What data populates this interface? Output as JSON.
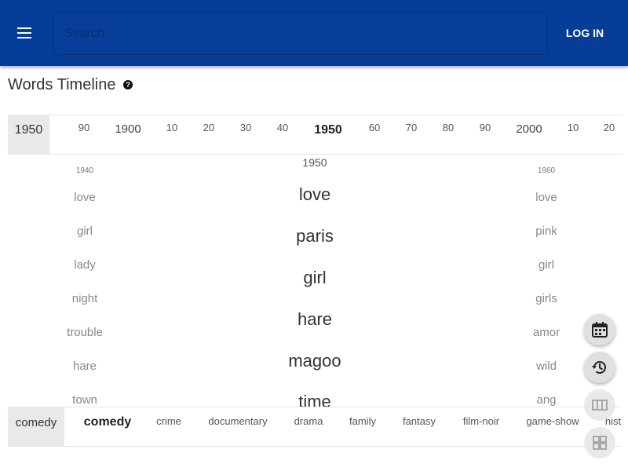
{
  "header": {
    "search_placeholder": "Search",
    "login_label": "LOG IN"
  },
  "page": {
    "title": "Words Timeline",
    "help_symbol": "?"
  },
  "year_nav": {
    "current": "1950",
    "ticks": [
      "90",
      "1900",
      "10",
      "20",
      "30",
      "40",
      "1950",
      "60",
      "70",
      "80",
      "90",
      "2000",
      "10",
      "20"
    ]
  },
  "columns": {
    "left": {
      "year": "1940",
      "words": [
        "love",
        "girl",
        "lady",
        "night",
        "trouble",
        "hare",
        "town"
      ]
    },
    "center": {
      "year": "1950",
      "words": [
        "love",
        "paris",
        "girl",
        "hare",
        "magoo",
        "time"
      ]
    },
    "right": {
      "year": "1960",
      "words": [
        "love",
        "pink",
        "girl",
        "girls",
        "amor",
        "wild",
        "ang"
      ]
    }
  },
  "genre_nav": {
    "current": "comedy",
    "genres": [
      "comedy",
      "crime",
      "documentary",
      "drama",
      "family",
      "fantasy",
      "film-noir",
      "game-show",
      "hist"
    ]
  },
  "fabs": [
    "calendar-icon",
    "history-icon",
    "view-column-icon",
    "grid-icon"
  ]
}
